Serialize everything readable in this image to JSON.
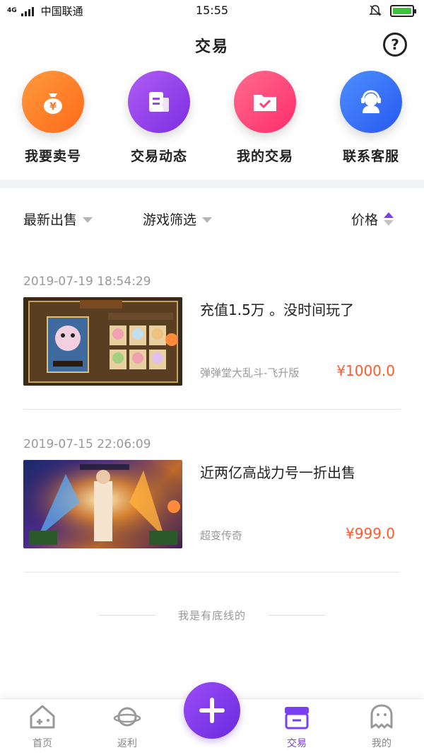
{
  "status_bar": {
    "network": "4G",
    "carrier": "中国联通",
    "time": "15:55"
  },
  "header": {
    "title": "交易"
  },
  "quick_actions": [
    {
      "label": "我要卖号",
      "icon": "money-bag-icon",
      "color": "#ff7a24"
    },
    {
      "label": "交易动态",
      "icon": "document-icon",
      "color": "#9a45ec"
    },
    {
      "label": "我的交易",
      "icon": "folder-check-icon",
      "color": "#ff3f74"
    },
    {
      "label": "联系客服",
      "icon": "customer-service-icon",
      "color": "#3572f6"
    }
  ],
  "filters": {
    "latest": "最新出售",
    "game": "游戏筛选",
    "price": "价格"
  },
  "listings": [
    {
      "date": "2019-07-19 18:54:29",
      "title": "充值1.5万 。没时间玩了",
      "game": "弹弹堂大乱斗-飞升版",
      "price": "¥1000.0"
    },
    {
      "date": "2019-07-15 22:06:09",
      "title": "近两亿高战力号一折出售",
      "game": "超变传奇",
      "price": "¥999.0"
    }
  ],
  "end_text": "我是有底线的",
  "tabbar": [
    {
      "label": "首页",
      "icon": "home-icon"
    },
    {
      "label": "返利",
      "icon": "planet-icon"
    },
    {
      "label": "交易",
      "icon": "box-icon",
      "active": true
    },
    {
      "label": "我的",
      "icon": "ghost-icon"
    }
  ],
  "colors": {
    "accent": "#7a3ff0",
    "price": "#ff5a2e"
  }
}
